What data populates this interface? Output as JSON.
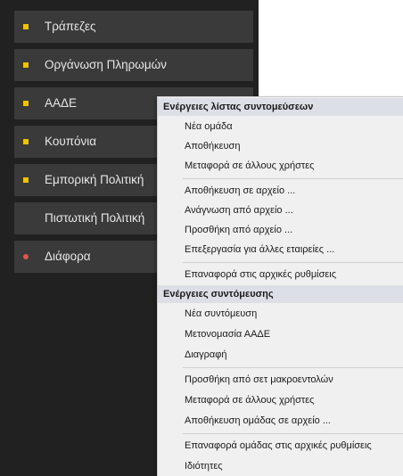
{
  "sidebar": {
    "items": [
      {
        "label": "Τράπεζες",
        "bullet": "square"
      },
      {
        "label": "Οργάνωση Πληρωμών",
        "bullet": "square"
      },
      {
        "label": "ΑΑΔΕ",
        "bullet": "square"
      },
      {
        "label": "Κουπόνια",
        "bullet": "square"
      },
      {
        "label": "Εμπορική Πολιτική",
        "bullet": "square"
      },
      {
        "label": "Πιστωτική Πολιτική",
        "bullet": "none"
      },
      {
        "label": "Διάφορα",
        "bullet": "dot"
      }
    ]
  },
  "context_menu": {
    "section1": {
      "header": "Ενέργειες λίστας συντομεύσεων",
      "items": [
        "Νέα ομάδα",
        "Αποθήκευση",
        "Μεταφορά σε άλλους χρήστες",
        "Αποθήκευση σε αρχείο ...",
        "Ανάγνωση από αρχείο ...",
        "Προσθήκη από αρχείο ...",
        "Επεξεργασία για άλλες εταιρείες ...",
        "Επαναφορά στις αρχικές ρυθμίσεις"
      ]
    },
    "section2": {
      "header": "Ενέργειες συντόμευσης",
      "items": [
        "Νέα συντόμευση",
        "Μετονομασία  ΑΑΔΕ",
        "Διαγραφή",
        "Προσθήκη από σετ μακροεντολών",
        "Μεταφορά σε άλλους χρήστες",
        "Αποθήκευση ομάδας σε αρχείο ...",
        "Επαναφορά ομάδας στις αρχικές ρυθμίσεις",
        "Ιδιότητες"
      ]
    }
  },
  "colors": {
    "sidebar_bg": "#212121",
    "nav_item_bg": "#3a3a3a",
    "bullet_yellow": "#f2c200",
    "bullet_red": "#e0554c",
    "menu_bg": "#f0f0f0",
    "menu_header_bg": "#dcdfe6"
  }
}
